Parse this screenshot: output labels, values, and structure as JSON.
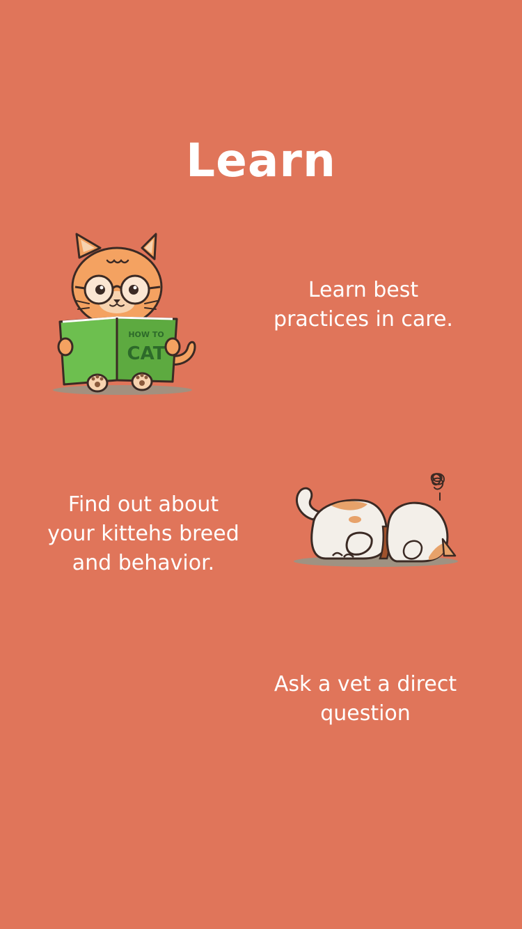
{
  "screen": {
    "title": "Learn",
    "background_color": "#e0755a"
  },
  "features": [
    {
      "text": "Learn best\npractices in care.",
      "illustration": "cat-reading-book-illustration",
      "book_text": "HOW TO\nCAT"
    },
    {
      "text": "Find out about\nyour kittehs breed\nand behavior.",
      "illustration": "cat-sleeping-illustration"
    },
    {
      "text": "Ask a vet a direct\nquestion"
    }
  ],
  "book": {
    "line1": "HOW TO",
    "line2": "CAT"
  }
}
